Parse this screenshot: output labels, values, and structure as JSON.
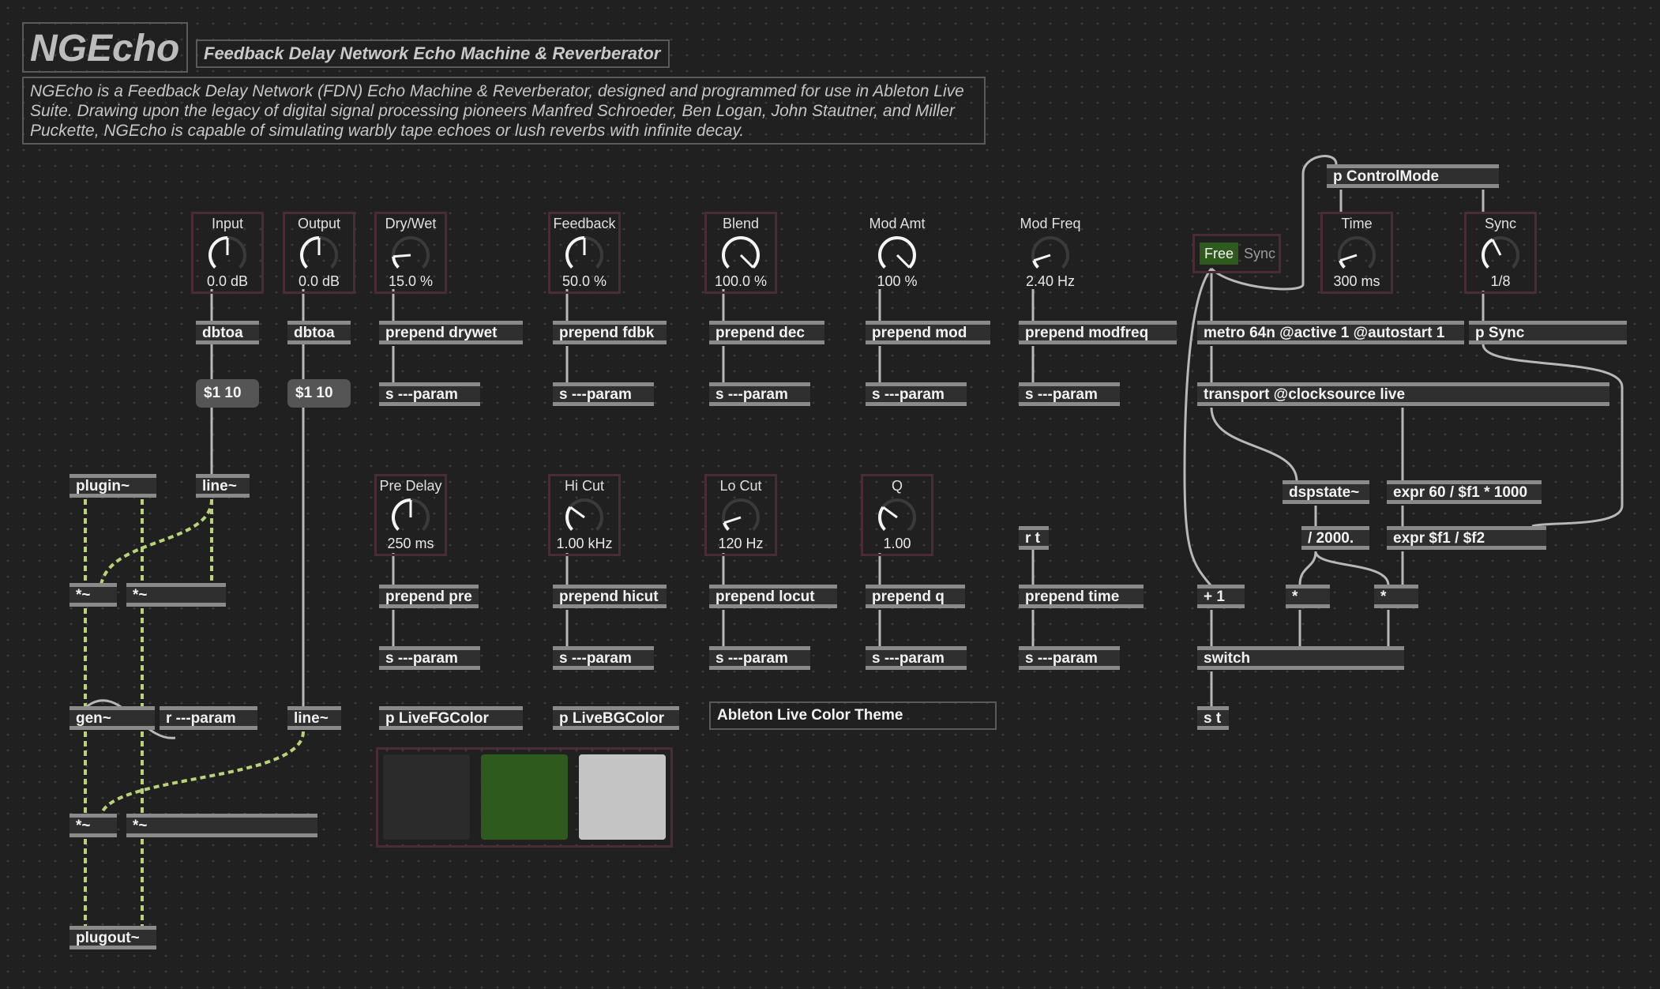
{
  "header": {
    "title": "NGEcho",
    "subtitle": "Feedback Delay Network Echo Machine & Reverberator",
    "description": "NGEcho is a Feedback Delay Network (FDN) Echo Machine & Reverberator, designed and programmed for use in Ableton Live Suite. Drawing upon the legacy of digital signal processing pioneers Manfred Schroeder, Ben Logan, John Stautner, and Miller Puckette, NGEcho is capable of simulating warbly tape echoes or lush reverbs with infinite decay."
  },
  "dials": {
    "input": {
      "label": "Input",
      "value": "0.0 dB",
      "level": 0.5
    },
    "output": {
      "label": "Output",
      "value": "0.0 dB",
      "level": 0.5
    },
    "drywet": {
      "label": "Dry/Wet",
      "value": "15.0 %",
      "level": 0.15
    },
    "feedback": {
      "label": "Feedback",
      "value": "50.0 %",
      "level": 0.5
    },
    "blend": {
      "label": "Blend",
      "value": "100.0 %",
      "level": 1.0
    },
    "modamt": {
      "label": "Mod Amt",
      "value": "100 %",
      "level": 1.0
    },
    "modfreq": {
      "label": "Mod Freq",
      "value": "2.40 Hz",
      "level": 0.1
    },
    "time": {
      "label": "Time",
      "value": "300 ms",
      "level": 0.1
    },
    "sync": {
      "label": "Sync",
      "value": "1/8",
      "level": 0.4
    },
    "predelay": {
      "label": "Pre Delay",
      "value": "250 ms",
      "level": 0.5
    },
    "hicut": {
      "label": "Hi Cut",
      "value": "1.00 kHz",
      "level": 0.3
    },
    "locut": {
      "label": "Lo Cut",
      "value": "120 Hz",
      "level": 0.1
    },
    "q": {
      "label": "Q",
      "value": "1.00",
      "level": 0.3
    }
  },
  "dial_colors": {
    "active": "#f4f4f4",
    "track": "#3a3a3a",
    "border": "#4a2c36"
  },
  "mode_tab": {
    "free": "Free",
    "sync": "Sync",
    "selected": "Free"
  },
  "objects": {
    "dbtoa": "dbtoa",
    "msg_ramp": "$1 10",
    "plugin": "plugin~",
    "line": "line~",
    "mul": "*~",
    "gen": "gen~",
    "r_param": "r ---param",
    "plugout": "plugout~",
    "s_param": "s ---param",
    "prepend_drywet": "prepend drywet",
    "prepend_fdbk": "prepend fdbk",
    "prepend_dec": "prepend dec",
    "prepend_mod": "prepend mod",
    "prepend_modfreq": "prepend modfreq",
    "prepend_pre": "prepend pre",
    "prepend_hicut": "prepend hicut",
    "prepend_locut": "prepend locut",
    "prepend_q": "prepend q",
    "prepend_time": "prepend time",
    "r_t": "r t",
    "p_fg": "p LiveFGColor",
    "p_bg": "p LiveBGColor",
    "color_theme": "Ableton Live Color Theme",
    "p_controlmode": "p ControlMode",
    "metro": "metro 64n @active 1 @autostart 1",
    "p_sync": "p Sync",
    "transport": "transport @clocksource live",
    "dspstate": "dspstate~",
    "expr1": "expr 60 / $f1 * 1000",
    "div2000": "/ 2000.",
    "expr2": "expr $f1 / $f2",
    "plus1": "+ 1",
    "star": "*",
    "switch": "switch",
    "s_t": "s t"
  },
  "swatches": [
    "#2b2b2b",
    "#2f5a1e",
    "#c4c4c4"
  ],
  "cord_colors": {
    "signal": "#b9d37a",
    "control": "#b8b8b8"
  }
}
